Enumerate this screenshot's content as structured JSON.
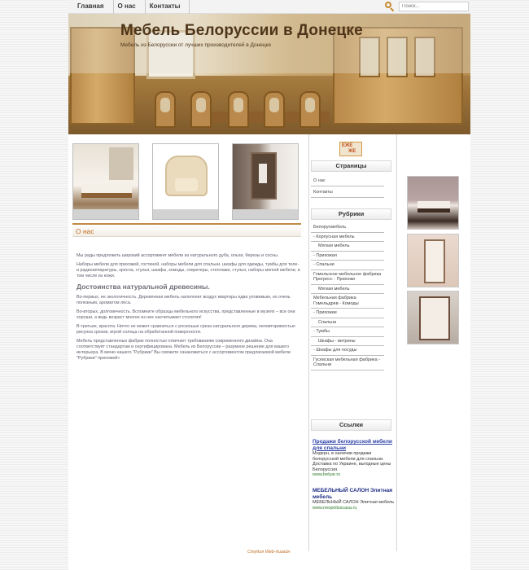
{
  "nav": {
    "items": [
      "Главная",
      "О нас",
      "Контакты"
    ]
  },
  "search": {
    "placeholder": "Поиск..."
  },
  "header": {
    "title": "Мебель Белоруссии в Донецке",
    "subtitle": "Мебель из Белоруссии от лучших производителей в Донецке"
  },
  "section": {
    "title": "О нас"
  },
  "content": {
    "p1": "Мы рады предложить широкий ассортимент мебели из натурального дуба, ольхи, березы и сосны.",
    "p2": "Наборы мебели для прихожей, гостиной, наборы мебели для спальни, шкафы для одежды, тумбы для теле- и радиоаппаратуры, кресла, стулья, шкафы, комоды, секретеры, стеллажи, стулья, наборы мягкой мебели, и том числе из кожи.",
    "h2": "Достоинства натуральной древесины.",
    "p3": "Во-первых, ее экологичность. Деревянная мебель наполняет воздух квартиры едва уловимым, но очень полезным, ароматом леса.",
    "p4": "Во-вторых, долговечность. Вспомните образцы мебельного искусства, представленные в музеях – все они хороши, а ведь возраст многих из них насчитывает столетия!",
    "p5": "В-третьих, красота. Ничто не может сравниться с роскошью среза натурального дерева, неповторимостью рисунка срезов, игрой солнца на обработанной поверхности.",
    "p6": "Мебель представленных фабрик полностью отвечает требованиям современного дизайна. Она соответствует стандартам и сертифицирована. Мебель из Белоруссии – разумное решение для вашего интерьера. В меню нашего \"Рубрики\" Вы сможете ознакомиться с ассортиментом предлагаемой мебели \"Рубрики\" прихожей»"
  },
  "sidebar": {
    "logo_top": "ЕЖЕ",
    "logo_bottom": "ЖЕ",
    "pages_title": "Страницы",
    "pages": [
      "О нас",
      "Контакты"
    ],
    "rubrics_title": "Рубрики",
    "rubrics": [
      {
        "label": "Белорусмебель",
        "indent": false
      },
      {
        "label": "- Корпусная мебель",
        "indent": false
      },
      {
        "label": "Мягкая мебель",
        "indent": true
      },
      {
        "label": "- Прихожая",
        "indent": false
      },
      {
        "label": "- Спальни",
        "indent": false
      },
      {
        "label": "Гомельское мебельное фабрика Прогресс - Прихожи",
        "indent": false
      },
      {
        "label": "Мягкая мебель",
        "indent": true
      },
      {
        "label": "Мебельная фабрика Гомельдрев - Комоды",
        "indent": false
      },
      {
        "label": "- Прихожие",
        "indent": false
      },
      {
        "label": "Спальни",
        "indent": true
      },
      {
        "label": "- Тумбы",
        "indent": false
      },
      {
        "label": "Шкафы - витрины",
        "indent": true
      },
      {
        "label": "- Шкафы для посуды",
        "indent": false
      },
      {
        "label": "Гусевская мебельная фабрика - Спальни",
        "indent": false
      }
    ],
    "links_title": "Ссылки",
    "ad1": {
      "title": "Продажи белорусской мебели для спальни",
      "text": "Модерн, в наличии продажи белорусской мебели для спальни. Доставка по Украине, выгодные цены Белоруссия.",
      "url": "www.belyar.ru"
    },
    "ad2": {
      "title": "МЕБЕЛЬНЫЙ САЛОН Элитная мебель",
      "text": "МЕБЕЛЬНЫЙ САЛОН Элитная мебель",
      "url": "www.neopolisscasa.ru"
    }
  },
  "footer": {
    "text": "Студия Web-дизайн"
  }
}
